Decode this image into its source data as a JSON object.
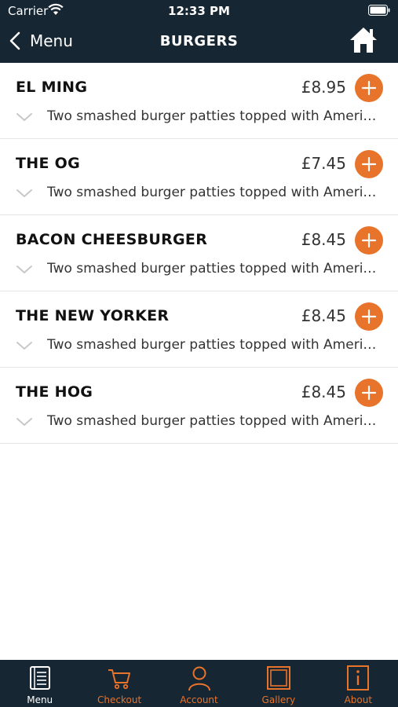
{
  "status_bar": {
    "carrier": "Carrier",
    "time": "12:33 PM"
  },
  "nav": {
    "back_label": "Menu",
    "title": "BURGERS"
  },
  "items": [
    {
      "name": "EL MING",
      "price": "£8.95",
      "description": "Two smashed burger patties topped with American cheese"
    },
    {
      "name": "THE OG",
      "price": "£7.45",
      "description": "Two smashed burger patties topped with American cheese"
    },
    {
      "name": "BACON CHEESBURGER",
      "price": "£8.45",
      "description": "Two smashed burger patties topped with American cheese"
    },
    {
      "name": "THE NEW YORKER",
      "price": "£8.45",
      "description": "Two smashed burger patties topped with American cheese"
    },
    {
      "name": "THE HOG",
      "price": "£8.45",
      "description": "Two smashed burger patties topped with American cheese"
    }
  ],
  "tabs": [
    {
      "label": "Menu",
      "icon": "menu-book-icon",
      "active": true
    },
    {
      "label": "Checkout",
      "icon": "cart-icon",
      "active": false
    },
    {
      "label": "Account",
      "icon": "person-icon",
      "active": false
    },
    {
      "label": "Gallery",
      "icon": "gallery-icon",
      "active": false
    },
    {
      "label": "About",
      "icon": "info-icon",
      "active": false
    }
  ],
  "colors": {
    "header_bg": "#162633",
    "accent": "#e8732a",
    "active_tab": "#ffffff"
  }
}
